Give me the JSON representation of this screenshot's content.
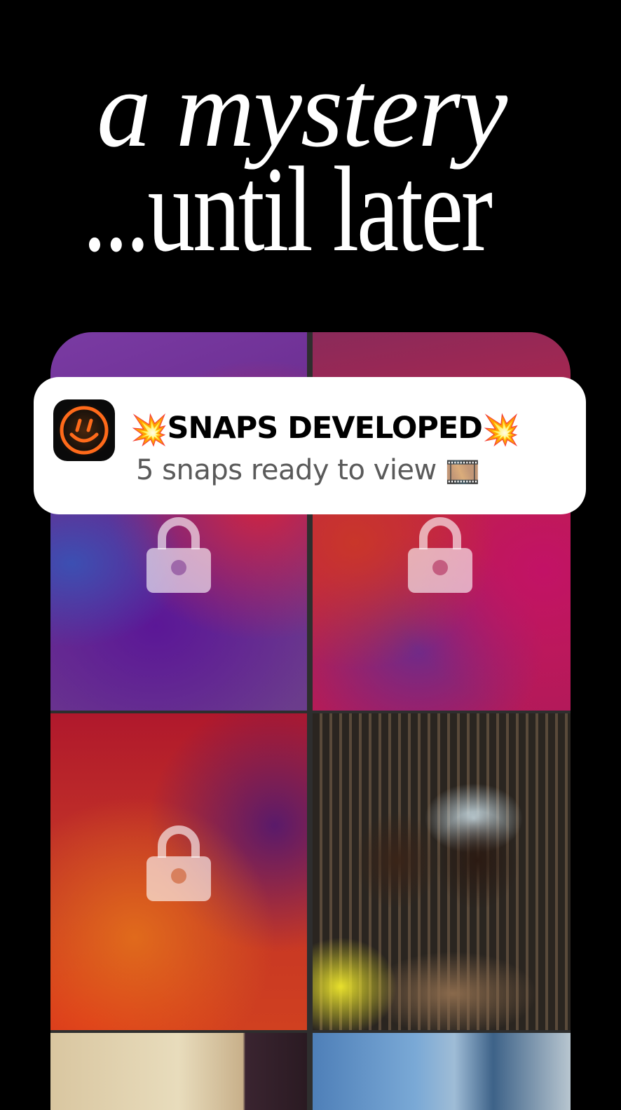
{
  "headline": {
    "line1": "a mystery",
    "line2": "...until later"
  },
  "notification": {
    "app_icon": "smiley-logo-icon",
    "title_prefix_emoji": "💥",
    "title": "SNAPS DEVELOPED",
    "title_suffix_emoji": "💥",
    "body": "5 snaps ready to view",
    "body_emoji": "🎞️"
  },
  "grid": {
    "tiles": [
      {
        "state": "locked",
        "icon": "lock-icon"
      },
      {
        "state": "locked",
        "icon": "lock-icon"
      },
      {
        "state": "locked",
        "icon": "lock-icon"
      },
      {
        "state": "developed",
        "content": "photo"
      },
      {
        "state": "developed",
        "content": "photo"
      },
      {
        "state": "developed",
        "content": "photo"
      }
    ]
  },
  "colors": {
    "background": "#000000",
    "card": "#ffffff",
    "accent_orange": "#ff6a1a"
  }
}
